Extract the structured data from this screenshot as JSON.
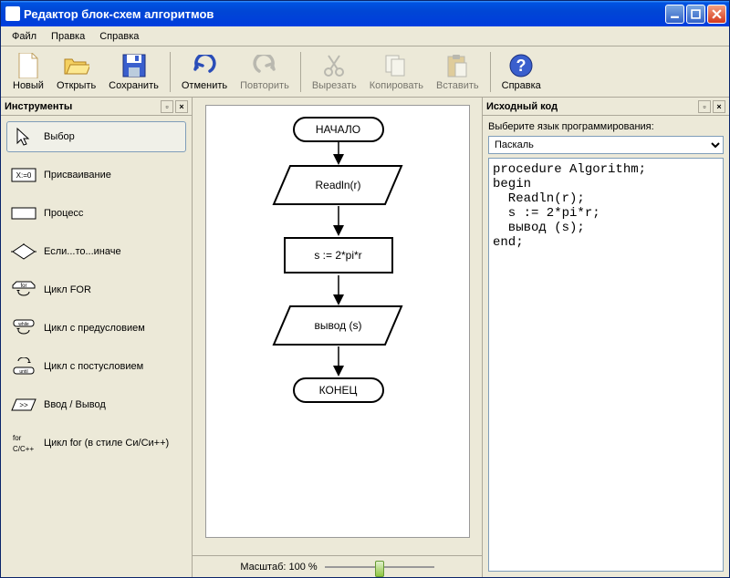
{
  "window": {
    "title": "Редактор блок-схем алгоритмов"
  },
  "menu": {
    "file": "Файл",
    "edit": "Правка",
    "help": "Справка"
  },
  "toolbar": {
    "new": "Новый",
    "open": "Открыть",
    "save": "Сохранить",
    "undo": "Отменить",
    "redo": "Повторить",
    "cut": "Вырезать",
    "copy": "Копировать",
    "paste": "Вставить",
    "help": "Справка"
  },
  "panels": {
    "tools_title": "Инструменты",
    "code_title": "Исходный код"
  },
  "tools": {
    "select": "Выбор",
    "assign": "Присваивание",
    "process": "Процесс",
    "if": "Если...то...иначе",
    "for": "Цикл FOR",
    "while": "Цикл с предусловием",
    "until": "Цикл с постусловием",
    "io": "Ввод / Вывод",
    "cfor": "Цикл for (в стиле Си/Си++)"
  },
  "canvas": {
    "zoom_label": "Масштаб: 100 %",
    "nodes": {
      "start": "НАЧАЛО",
      "input": "Readln(r)",
      "calc": "s := 2*pi*r",
      "output": "вывод (s)",
      "end": "КОНЕЦ"
    }
  },
  "code": {
    "lang_label": "Выберите язык программирования:",
    "lang_value": "Паскаль",
    "source": "procedure Algorithm;\nbegin\n  Readln(r);\n  s := 2*pi*r;\n  вывод (s);\nend;"
  },
  "chart_data": {
    "type": "flowchart",
    "nodes": [
      {
        "id": "start",
        "kind": "terminator",
        "label": "НАЧАЛО"
      },
      {
        "id": "input",
        "kind": "io",
        "label": "Readln(r)"
      },
      {
        "id": "calc",
        "kind": "process",
        "label": "s := 2*pi*r"
      },
      {
        "id": "output",
        "kind": "io",
        "label": "вывод (s)"
      },
      {
        "id": "end",
        "kind": "terminator",
        "label": "КОНЕЦ"
      }
    ],
    "edges": [
      [
        "start",
        "input"
      ],
      [
        "input",
        "calc"
      ],
      [
        "calc",
        "output"
      ],
      [
        "output",
        "end"
      ]
    ]
  }
}
